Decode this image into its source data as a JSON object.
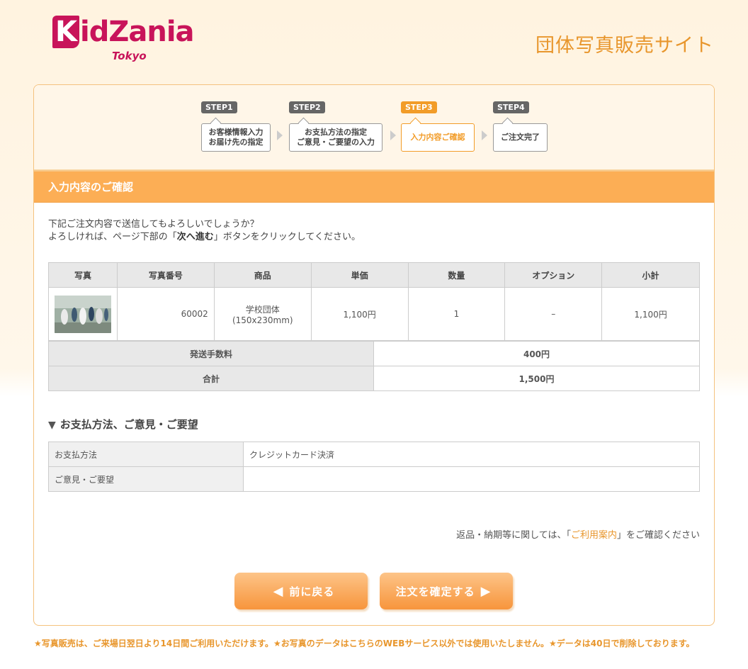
{
  "header": {
    "logo_main": "idZania",
    "logo_k": "K",
    "logo_sub": "Tokyo",
    "site_title": "団体写真販売サイト"
  },
  "steps": [
    {
      "tag": "STEP1",
      "line1": "お客様情報入力",
      "line2": "お届け先の指定",
      "active": false
    },
    {
      "tag": "STEP2",
      "line1": "お支払方法の指定",
      "line2": "ご意見・ご要望の入力",
      "active": false
    },
    {
      "tag": "STEP3",
      "line1": "入力内容ご確認",
      "line2": "",
      "active": true
    },
    {
      "tag": "STEP4",
      "line1": "ご注文完了",
      "line2": "",
      "active": false
    }
  ],
  "section_title": "入力内容のご確認",
  "intro": {
    "line1": "下記ご注文内容で送信してもよろしいでしょうか？",
    "line2_pre": "よろしければ、ページ下部の「",
    "line2_bold": "次へ進む",
    "line2_post": "」ボタンをクリックしてください。"
  },
  "order_table": {
    "headers": [
      "写真",
      "写真番号",
      "商品",
      "単価",
      "数量",
      "オプション",
      "小計"
    ],
    "rows": [
      {
        "photo_no": "60002",
        "product_line1": "学校団体",
        "product_line2": "(150x230mm)",
        "unit_price": "1,100円",
        "qty": "1",
        "option": "–",
        "subtotal": "1,100円"
      }
    ]
  },
  "summary": {
    "shipping_label": "発送手数料",
    "shipping_value": "400円",
    "total_label": "合計",
    "total_value": "1,500円"
  },
  "payment_section": {
    "title": "お支払方法、ご意見・ご要望",
    "method_label": "お支払方法",
    "method_value": "クレジットカード決済",
    "comment_label": "ご意見・ご要望",
    "comment_value": ""
  },
  "note": {
    "pre": "返品・納期等に関しては、「",
    "link": "ご利用案内",
    "post": "」をご確認ください"
  },
  "buttons": {
    "back": "前に戻る",
    "next": "注文を確定する"
  },
  "footer": "★写真販売は、ご来場日翌日より14日間ご利用いただけます。★お写真のデータはこちらのWEBサービス以外では使用いたしません。★データは40日で削除しております。",
  "colors": {
    "brand": "#c8145a",
    "accent": "#f29c28",
    "section_bar": "#fcae55"
  }
}
